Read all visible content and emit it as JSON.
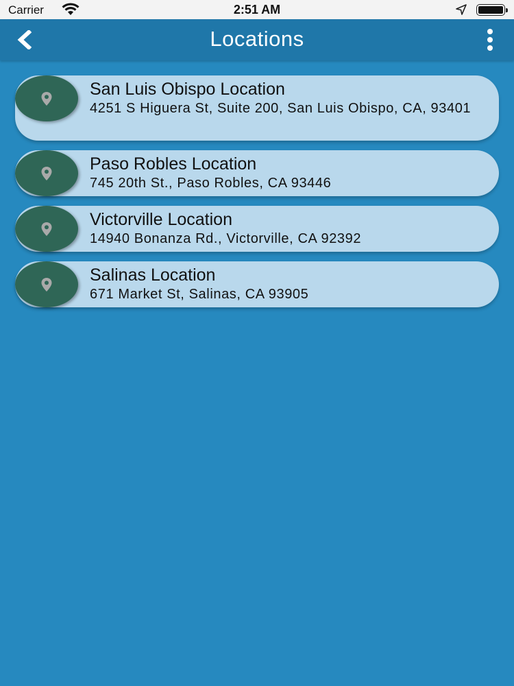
{
  "status_bar": {
    "carrier": "Carrier",
    "time": "2:51 AM",
    "icons": [
      "wifi-icon",
      "location-arrow-icon",
      "battery-icon"
    ]
  },
  "nav": {
    "title": "Locations",
    "back_icon": "chevron-left-icon",
    "menu_icon": "more-vertical-icon"
  },
  "colors": {
    "background": "#2689bf",
    "nav_bar": "#1f77a9",
    "card": "#b9d8ec",
    "pin_circle": "#2f6656",
    "pin_icon": "#a9a9a9"
  },
  "locations": [
    {
      "name": "San Luis Obispo Location",
      "address": "4251 S Higuera St, Suite 200, San Luis Obispo, CA, 93401",
      "icon": "map-pin-icon"
    },
    {
      "name": "Paso Robles Location",
      "address": "745 20th St., Paso Robles, CA 93446",
      "icon": "map-pin-icon"
    },
    {
      "name": "Victorville Location",
      "address": "14940 Bonanza Rd., Victorville, CA 92392",
      "icon": "map-pin-icon"
    },
    {
      "name": "Salinas Location",
      "address": "671 Market St, Salinas, CA 93905",
      "icon": "map-pin-icon"
    }
  ]
}
